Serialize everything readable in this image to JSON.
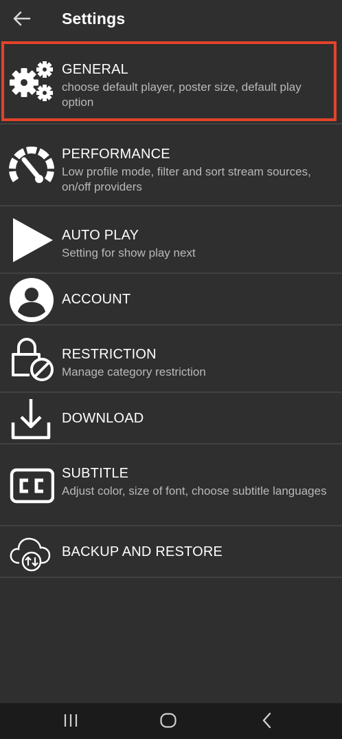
{
  "header": {
    "back_icon": "arrow-left-icon",
    "title": "Settings"
  },
  "accent_color": "#e4432a",
  "items": [
    {
      "key": "general",
      "icon": "gears-icon",
      "label": "GENERAL",
      "description": "choose default player, poster size, default play option",
      "selected": true
    },
    {
      "key": "performance",
      "icon": "speedometer-icon",
      "label": "PERFORMANCE",
      "description": "Low profile mode, filter and sort stream sources, on/off providers"
    },
    {
      "key": "auto_play",
      "icon": "play-icon",
      "label": "AUTO PLAY",
      "description": "Setting for show play next"
    },
    {
      "key": "account",
      "icon": "account-icon",
      "label": "ACCOUNT",
      "description": ""
    },
    {
      "key": "restriction",
      "icon": "lock-restriction-icon",
      "label": "RESTRICTION",
      "description": "Manage category restriction"
    },
    {
      "key": "download",
      "icon": "download-icon",
      "label": "DOWNLOAD",
      "description": ""
    },
    {
      "key": "subtitle",
      "icon": "closed-captions-icon",
      "label": "SUBTITLE",
      "description": "Adjust color, size of font, choose subtitle languages"
    },
    {
      "key": "backup",
      "icon": "cloud-sync-icon",
      "label": "BACKUP AND RESTORE",
      "description": ""
    }
  ],
  "navbar": {
    "recents_icon": "recents-icon",
    "home_icon": "home-icon",
    "back_icon": "back-chevron-icon"
  }
}
